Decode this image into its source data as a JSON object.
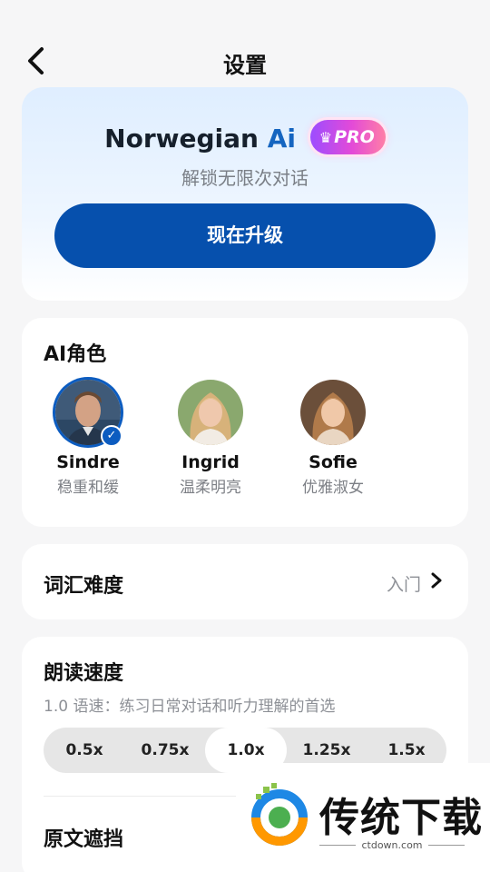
{
  "header": {
    "title": "设置"
  },
  "promo": {
    "app_name": "Norwegian",
    "app_name_ai": "Ai",
    "badge": "PRO",
    "subtitle": "解锁无限次对话",
    "upgrade_label": "现在升级"
  },
  "roles": {
    "title": "AI角色",
    "items": [
      {
        "name": "Sindre",
        "desc": "稳重和缓",
        "selected": true
      },
      {
        "name": "Ingrid",
        "desc": "温柔明亮",
        "selected": false
      },
      {
        "name": "Sofie",
        "desc": "优雅淑女",
        "selected": false
      }
    ]
  },
  "vocab": {
    "label": "词汇难度",
    "value": "入门"
  },
  "speed": {
    "title": "朗读速度",
    "description": "1.0 语速：练习日常对话和听力理解的首选",
    "options": [
      "0.5x",
      "0.75x",
      "1.0x",
      "1.25x",
      "1.5x"
    ],
    "selected": "1.0x"
  },
  "original_text": {
    "label": "原文遮挡"
  },
  "watermark": {
    "text": "传统下载",
    "url": "ctdown.com"
  },
  "colors": {
    "accent": "#0650ad",
    "selected_ring": "#0c5cc0",
    "background": "#f6f6f7"
  }
}
